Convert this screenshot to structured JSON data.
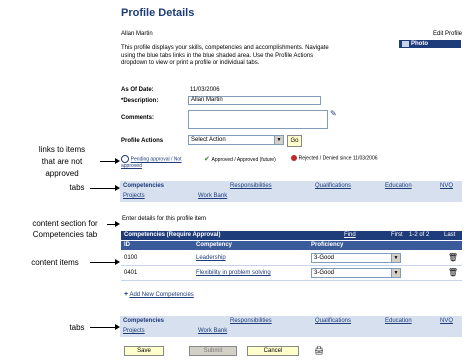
{
  "page": {
    "title": "Profile Details",
    "employee_name": "Allan Martin",
    "edit_profile": "Edit Profile",
    "photo_button": "Photo",
    "description_lines": [
      "This profile displays your skills, competencies and accomplishments. Navigate",
      "using the blue tabs links in the blue shaded area. Use the Profile Actions",
      "dropdown to view or print a profile or individual tabs."
    ]
  },
  "form": {
    "as_of_date_label": "As Of Date:",
    "as_of_date_value": "11/03/2006",
    "description_label": "*Description:",
    "description_value": "Allan Martin",
    "comments_label": "Comments:",
    "profile_actions_label": "Profile Actions",
    "profile_actions_value": "Select Action",
    "go_button": "Go"
  },
  "status": {
    "items": [
      {
        "text": "Pending approval / Not approved",
        "color": "#1f3c7a"
      },
      {
        "text": "Approved / Approved (future)",
        "color": "#2e8b2e"
      },
      {
        "text": "Rejected / Denied since 11/03/2006",
        "color": "#c0282c"
      }
    ]
  },
  "tabs_top": [
    "Competencies",
    "Responsibilities",
    "Qualifications",
    "Education",
    "NVQ",
    "Projects",
    "Work Bank"
  ],
  "tabs_bottom": [
    "Competencies",
    "Responsibilities",
    "Qualifications",
    "Education",
    "NVQ",
    "Projects",
    "Work Bank"
  ],
  "content": {
    "intro": "Enter details for this profile item",
    "section_title": "Competencies (Require Approval)",
    "section_controls": [
      "Find",
      "First",
      "1-2 of 2",
      "Last"
    ],
    "columns": [
      "ID",
      "Competency",
      "Proficiency"
    ],
    "rows": [
      {
        "id": "0100",
        "competency": "Leadership",
        "proficiency": "3-Good"
      },
      {
        "id": "0401",
        "competency": "Flexibility in problem solving",
        "proficiency": "3-Good"
      }
    ],
    "add_link": "Add New Competencies"
  },
  "buttons": {
    "save": "Save",
    "submit": "Submit",
    "cancel": "Cancel"
  },
  "callouts": {
    "links_unapproved": [
      "links to items",
      "that are not",
      "approved"
    ],
    "tabs_top": "tabs",
    "content_section": [
      "content section for",
      "Competencies tab"
    ],
    "content_items": "content items",
    "tabs_bottom": "tabs"
  },
  "colors": {
    "brand": "#1f3c7a",
    "tab_background": "#d6e0ef",
    "button_yellow": "#ffffcc"
  }
}
